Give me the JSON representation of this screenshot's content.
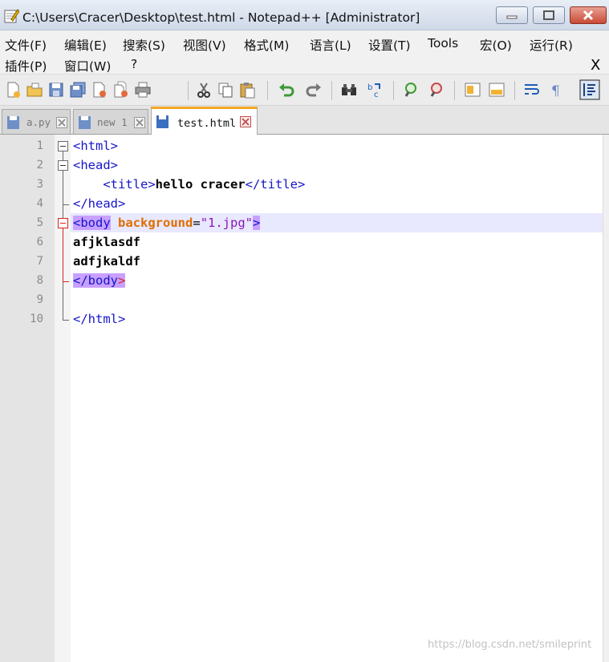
{
  "window": {
    "title": "C:\\Users\\Cracer\\Desktop\\test.html - Notepad++ [Administrator]"
  },
  "menu": {
    "items": [
      "文件(F)",
      "编辑(E)",
      "搜索(S)",
      "视图(V)",
      "格式(M)",
      "语言(L)",
      "设置(T)",
      "Tools",
      "宏(O)",
      "运行(R)",
      "插件(P)",
      "窗口(W)",
      "?"
    ],
    "close_glyph": "X"
  },
  "toolbar": {
    "icons": [
      "new-file-icon",
      "open-file-icon",
      "save-icon",
      "save-all-icon",
      "close-icon",
      "close-all-icon",
      "print-icon",
      "cut-icon",
      "copy-icon",
      "paste-icon",
      "undo-icon",
      "redo-icon",
      "find-icon",
      "replace-icon",
      "zoom-in-icon",
      "zoom-out-icon",
      "sync-v-icon",
      "sync-h-icon",
      "word-wrap-icon",
      "show-all-chars-icon",
      "indent-guide-icon"
    ]
  },
  "tabs": [
    {
      "label": "a.py",
      "active": false
    },
    {
      "label": "new 1",
      "active": false
    },
    {
      "label": "test.html",
      "active": true
    }
  ],
  "editor": {
    "line_numbers": [
      "1",
      "2",
      "3",
      "4",
      "5",
      "6",
      "7",
      "8",
      "9",
      "10"
    ],
    "lines": {
      "l1": {
        "tag": "<html>"
      },
      "l2": {
        "tag": "<head>"
      },
      "l3": {
        "indent": "    ",
        "open": "<title>",
        "text": "hello cracer",
        "close": "</title>"
      },
      "l4": {
        "tag": "</head>"
      },
      "l5": {
        "open": "<body",
        "sp": " ",
        "attr": "background",
        "eq": "=",
        "val": "\"1.jpg\"",
        "close": ">"
      },
      "l6": {
        "text": "afjklasdf"
      },
      "l7": {
        "text": "adfjkaldf"
      },
      "l8": {
        "open": "</body",
        "close": ">"
      },
      "l10": {
        "tag": "</html>"
      }
    }
  },
  "watermark": "https://blog.csdn.net/smileprint",
  "colors": {
    "tag": "#1515c9",
    "attribute": "#e06d00",
    "string": "#8a18b5",
    "current_line": "#e8e8ff",
    "brace_match": "#c8a0ff",
    "active_tab_accent": "#f7a623"
  }
}
